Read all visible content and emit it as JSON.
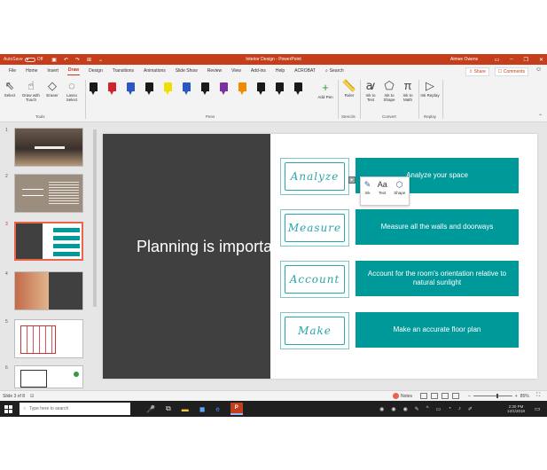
{
  "titlebar": {
    "autosave_label": "AutoSave",
    "autosave_state": "Off",
    "document_title": "Interior Design - PowerPoint",
    "user_name": "Aimee Owens"
  },
  "tabs": [
    "File",
    "Home",
    "Insert",
    "Draw",
    "Design",
    "Transitions",
    "Animations",
    "Slide Show",
    "Review",
    "View",
    "Add-ins",
    "Help",
    "ACROBAT"
  ],
  "active_tab": "Draw",
  "search_label": "Search",
  "share_label": "Share",
  "comments_label": "Comments",
  "ribbon": {
    "tools": {
      "select": "Select",
      "draw_with_touch": "Draw with Touch",
      "eraser": "Eraser",
      "lasso_select": "Lasso Select",
      "group_label": "Tools"
    },
    "pens_group_label": "Pens",
    "pen_colors": [
      "#1a1a1a",
      "#d1232a",
      "#2b57c4",
      "#1a1a1a",
      "#f0e000",
      "#2b57c4",
      "#1a1a1a",
      "#7c2fa0",
      "#f08a00",
      "#1a1a1a",
      "#1a1a1a",
      "#1a1a1a"
    ],
    "add_pen": "Add Pen",
    "stencils": {
      "ruler": "Ruler",
      "group_label": "Stencils"
    },
    "convert": {
      "ink_to_text": "Ink to Text",
      "ink_to_shape": "Ink to Shape",
      "ink_to_math": "Ink to Math",
      "group_label": "Convert"
    },
    "replay": {
      "ink_replay": "Ink Replay",
      "group_label": "Replay"
    }
  },
  "slides": {
    "numbers": [
      "1",
      "2",
      "3",
      "4",
      "5",
      "6"
    ],
    "selected": "3"
  },
  "slide": {
    "title": "Planning is important",
    "ink_words": [
      "Analyze",
      "Measure",
      "Account",
      "Make"
    ],
    "boxes": [
      "Analyze your space",
      "Measure all the walls and doorways",
      "Account for the room's orientation relative to natural sunlight",
      "Make an accurate floor plan"
    ],
    "ink_menu": [
      "Ink",
      "Text",
      "Shape"
    ],
    "accent_color": "#009999",
    "left_panel_color": "#404040"
  },
  "status": {
    "slide_count": "Slide 3 of 8",
    "notes_label": "Notes",
    "zoom": "85%"
  },
  "taskbar": {
    "search_placeholder": "Type here to search",
    "time": "2:30 PM",
    "date": "12/1/2018"
  }
}
